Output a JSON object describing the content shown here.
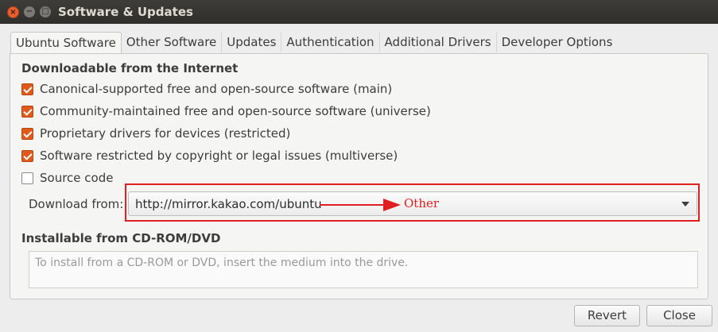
{
  "window": {
    "title": "Software & Updates"
  },
  "tabs": [
    {
      "label": "Ubuntu Software",
      "active": true
    },
    {
      "label": "Other Software"
    },
    {
      "label": "Updates"
    },
    {
      "label": "Authentication"
    },
    {
      "label": "Additional Drivers"
    },
    {
      "label": "Developer Options"
    }
  ],
  "downloadable": {
    "title": "Downloadable from the Internet",
    "items": [
      {
        "label": "Canonical-supported free and open-source software (main)",
        "checked": true
      },
      {
        "label": "Community-maintained free and open-source software (universe)",
        "checked": true
      },
      {
        "label": "Proprietary drivers for devices (restricted)",
        "checked": true
      },
      {
        "label": "Software restricted by copyright or legal issues (multiverse)",
        "checked": true
      },
      {
        "label": "Source code",
        "checked": false
      }
    ],
    "download_from_label": "Download from:",
    "download_from_value": "http://mirror.kakao.com/ubuntu"
  },
  "annotation": {
    "text": "Other",
    "color": "#e02020"
  },
  "cdrom": {
    "title": "Installable from CD-ROM/DVD",
    "placeholder": "To install from a CD-ROM or DVD, insert the medium into the drive."
  },
  "buttons": {
    "revert": "Revert",
    "close": "Close"
  },
  "colors": {
    "accent": "#e15a1d",
    "titlebar": "#3b3a36"
  }
}
